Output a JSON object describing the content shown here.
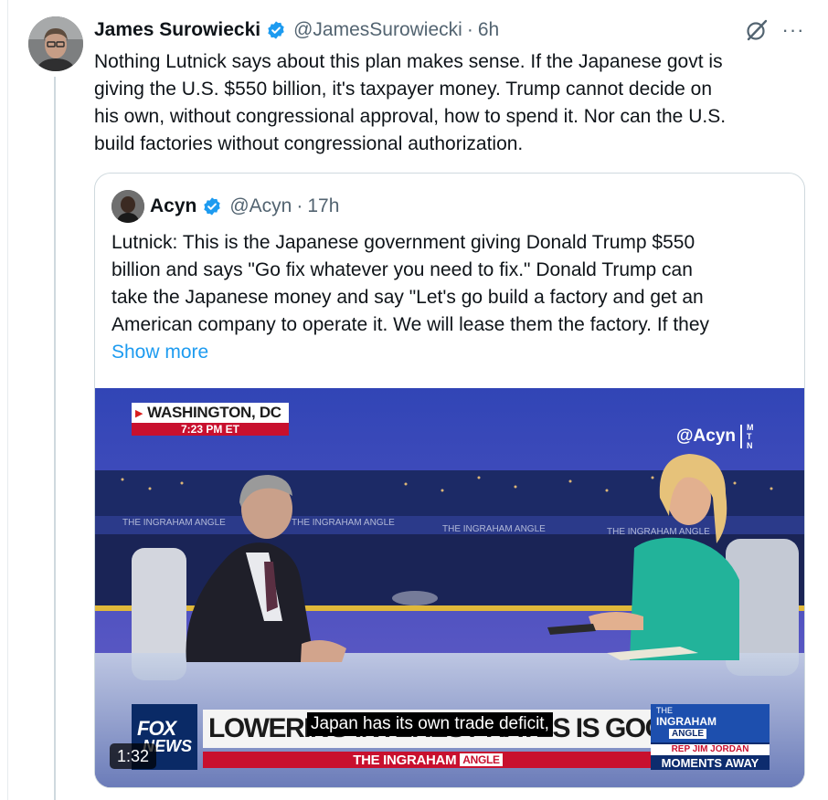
{
  "tweet": {
    "author_name": "James Surowiecki",
    "handle": "@JamesSurowiecki",
    "separator": "·",
    "time": "6h",
    "more_label": "···",
    "text": "Nothing Lutnick says about this plan makes sense. If the Japanese govt is\ngiving the U.S. $550 billion, it's taxpayer money. Trump cannot decide on\nhis own, without congressional approval, how to spend it. Nor can the U.S.\nbuild factories without congressional authorization."
  },
  "quote": {
    "author_name": "Acyn",
    "handle": "@Acyn",
    "separator": "·",
    "time": "17h",
    "text": "Lutnick: This is the Japanese government giving Donald Trump $550\nbillion and says \"Go fix whatever you need to fix.\" Donald Trump can\ntake the Japanese money and say \"Let's go build a factory and get an\nAmerican company to operate it. We will lease them the factory. If they",
    "show_more": "Show more"
  },
  "video": {
    "location": "WASHINGTON, DC",
    "location_time": "7:23 PM ET",
    "watermark_handle": "@Acyn",
    "watermark_letters": [
      "M",
      "T",
      "N"
    ],
    "fox_logo_line1": "FOX",
    "fox_logo_line2": "NEWS",
    "headline": "LOWERING INTEREST RATES IS GOOD FOR TRADE",
    "show_name": "THE INGRAHAM",
    "show_angle": "ANGLE",
    "backdrop_text": "THE INGRAHAM ANGLE",
    "promo_the": "THE",
    "promo_ingraham": "INGRAHAM",
    "promo_angle": "ANGLE",
    "promo_guest": "REP JIM JORDAN",
    "promo_moments": "MOMENTS AWAY",
    "caption": "Japan has its own trade deficit,",
    "duration": "1:32"
  },
  "colors": {
    "accent": "#1d9bf0",
    "text_secondary": "#536471",
    "border": "#cfd9de",
    "fox_red": "#c8102e",
    "fox_blue": "#0a2a66"
  },
  "icons": {
    "verified": "verified-badge-icon",
    "grok": "grok-icon",
    "more": "more-horizontal-icon"
  }
}
